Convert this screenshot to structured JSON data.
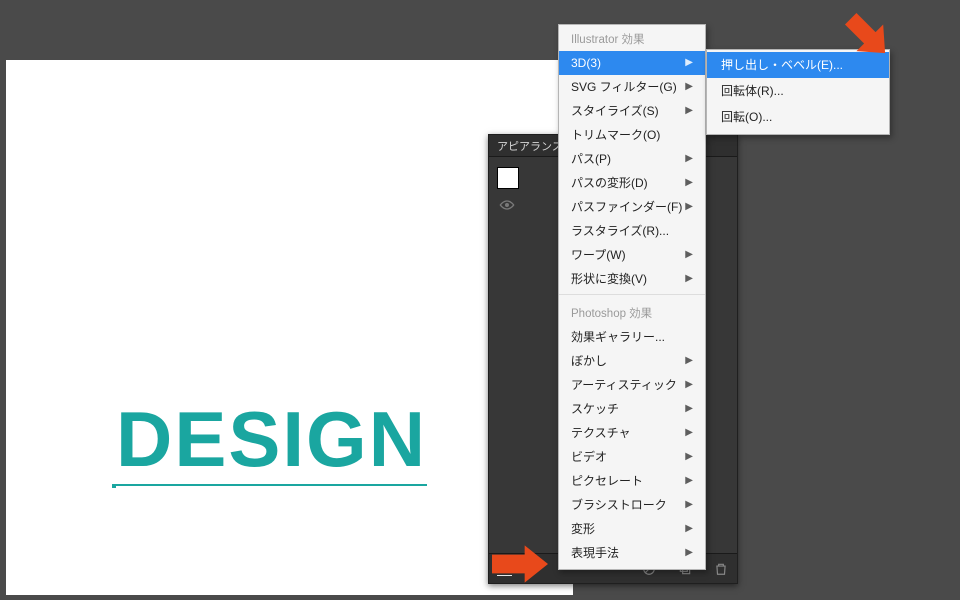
{
  "artboard": {
    "text": "DESIGN"
  },
  "appearance_panel": {
    "title": "アピアランス",
    "fx_label": "fx."
  },
  "menu": {
    "illustrator_header": "Illustrator 効果",
    "photoshop_header": "Photoshop 効果",
    "items_ill": [
      {
        "label": "3D(3)",
        "sub": true,
        "highlight": true
      },
      {
        "label": "SVG フィルター(G)",
        "sub": true
      },
      {
        "label": "スタイライズ(S)",
        "sub": true
      },
      {
        "label": "トリムマーク(O)",
        "sub": false
      },
      {
        "label": "パス(P)",
        "sub": true
      },
      {
        "label": "パスの変形(D)",
        "sub": true
      },
      {
        "label": "パスファインダー(F)",
        "sub": true
      },
      {
        "label": "ラスタライズ(R)...",
        "sub": false
      },
      {
        "label": "ワープ(W)",
        "sub": true
      },
      {
        "label": "形状に変換(V)",
        "sub": true
      }
    ],
    "items_ps": [
      {
        "label": "効果ギャラリー...",
        "sub": false
      },
      {
        "label": "ぼかし",
        "sub": true
      },
      {
        "label": "アーティスティック",
        "sub": true
      },
      {
        "label": "スケッチ",
        "sub": true
      },
      {
        "label": "テクスチャ",
        "sub": true
      },
      {
        "label": "ビデオ",
        "sub": true
      },
      {
        "label": "ピクセレート",
        "sub": true
      },
      {
        "label": "ブラシストローク",
        "sub": true
      },
      {
        "label": "変形",
        "sub": true
      },
      {
        "label": "表現手法",
        "sub": true
      }
    ]
  },
  "submenu": {
    "items": [
      {
        "label": "押し出し・ベベル(E)...",
        "highlight": true
      },
      {
        "label": "回転体(R)...",
        "highlight": false
      },
      {
        "label": "回転(O)...",
        "highlight": false
      }
    ]
  }
}
